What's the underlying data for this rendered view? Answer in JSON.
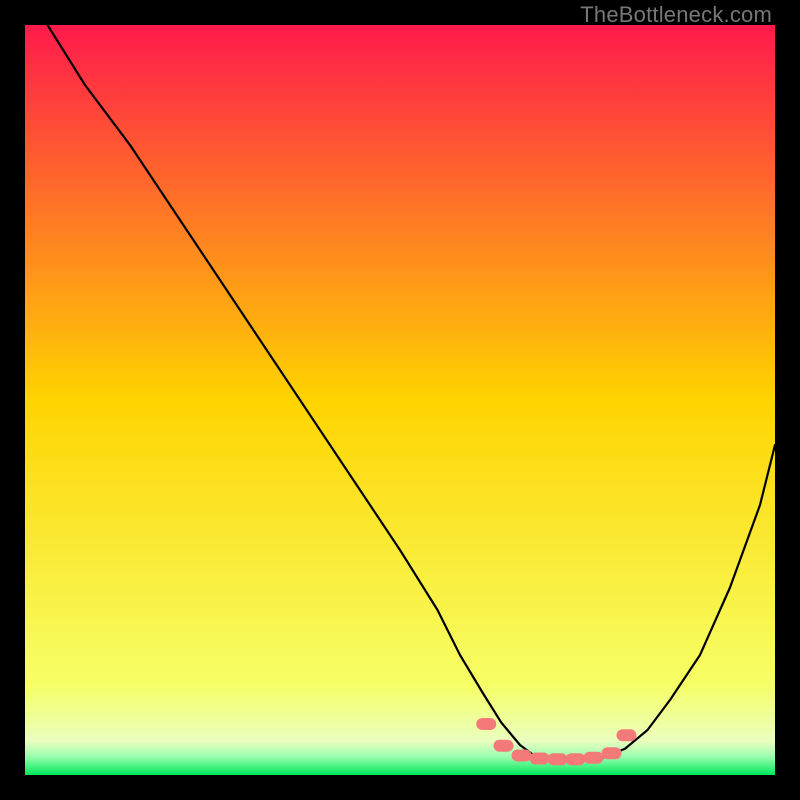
{
  "watermark": "TheBottleneck.com",
  "chart_data": {
    "type": "line",
    "title": "",
    "xlabel": "",
    "ylabel": "",
    "xlim": [
      0,
      100
    ],
    "ylim": [
      0,
      100
    ],
    "background_gradient": {
      "stops": [
        {
          "offset": 0.0,
          "color": "#ff1a4b"
        },
        {
          "offset": 0.5,
          "color": "#ffd400"
        },
        {
          "offset": 0.88,
          "color": "#f6ff66"
        },
        {
          "offset": 0.955,
          "color": "#eaffbf"
        },
        {
          "offset": 0.975,
          "color": "#9dffb0"
        },
        {
          "offset": 1.0,
          "color": "#00e85b"
        }
      ]
    },
    "series": [
      {
        "name": "bottleneck-curve",
        "color": "#000000",
        "width": 2.2,
        "x": [
          3,
          8,
          14,
          20,
          26,
          32,
          38,
          44,
          50,
          55,
          58,
          61,
          63.5,
          66,
          68,
          71,
          74,
          77,
          80,
          83,
          86,
          90,
          94,
          98,
          100
        ],
        "y": [
          100,
          92,
          84,
          75,
          66,
          57,
          48,
          39,
          30,
          22,
          16,
          11,
          7,
          4,
          2.5,
          2,
          2,
          2.3,
          3.5,
          6,
          10,
          16,
          25,
          36,
          44
        ]
      }
    ],
    "markers": {
      "name": "optimal-range",
      "shape": "rounded-pill",
      "color": "#f47a7a",
      "points": [
        {
          "x": 61.5,
          "y": 6.8
        },
        {
          "x": 63.8,
          "y": 3.9
        },
        {
          "x": 66.2,
          "y": 2.6
        },
        {
          "x": 68.6,
          "y": 2.2
        },
        {
          "x": 71.0,
          "y": 2.1
        },
        {
          "x": 73.4,
          "y": 2.1
        },
        {
          "x": 75.8,
          "y": 2.3
        },
        {
          "x": 78.2,
          "y": 2.9
        },
        {
          "x": 80.2,
          "y": 5.3
        }
      ]
    }
  }
}
